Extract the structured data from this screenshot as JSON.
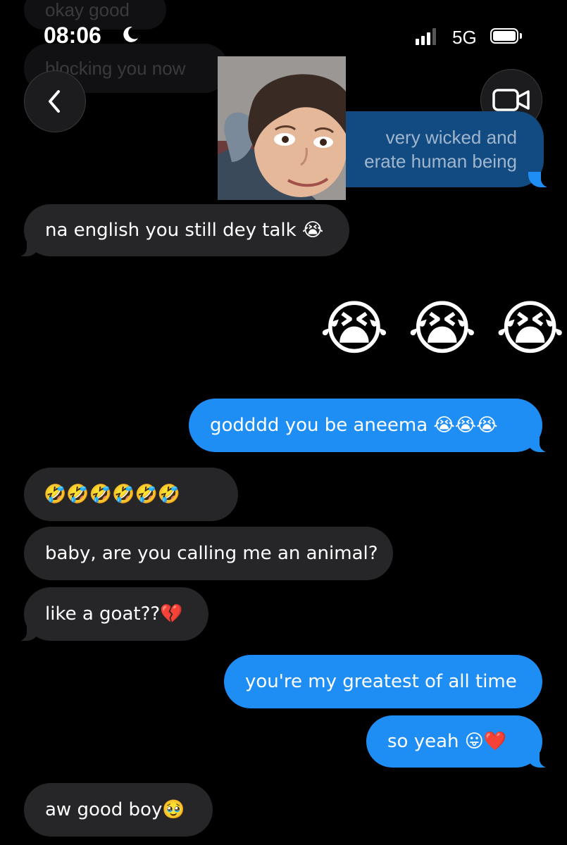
{
  "status_bar": {
    "time": "08:06",
    "network": "5G",
    "signal_bars": 3,
    "signal_bars_total": 4
  },
  "ghost_messages": [
    "okay good",
    "blocking you now"
  ],
  "partial_message": {
    "line1": "very wicked and",
    "line2": "erate human being"
  },
  "messages": [
    {
      "side": "in",
      "text": "na english you still dey talk 😭"
    },
    {
      "side": "out",
      "text": "😭 😭 😭",
      "big_emoji": true
    },
    {
      "side": "out",
      "text": "godddd you be aneema 😭😭😭"
    },
    {
      "side": "in",
      "text": "🤣🤣🤣🤣🤣🤣"
    },
    {
      "side": "in",
      "text": "baby, are you calling me an animal?"
    },
    {
      "side": "in",
      "text": "like a goat??💔"
    },
    {
      "side": "out",
      "text": "you're my greatest of all time"
    },
    {
      "side": "out",
      "text": "so yeah 😛❤️"
    },
    {
      "side": "in",
      "text": "aw good boy🥹"
    }
  ],
  "icons": {
    "back": "chevron-left-icon",
    "video": "video-camera-icon",
    "moon": "moon-icon",
    "battery": "battery-icon",
    "signal": "signal-icon"
  },
  "colors": {
    "incoming": "#262628",
    "outgoing": "#1e8ef5",
    "background": "#000000"
  }
}
